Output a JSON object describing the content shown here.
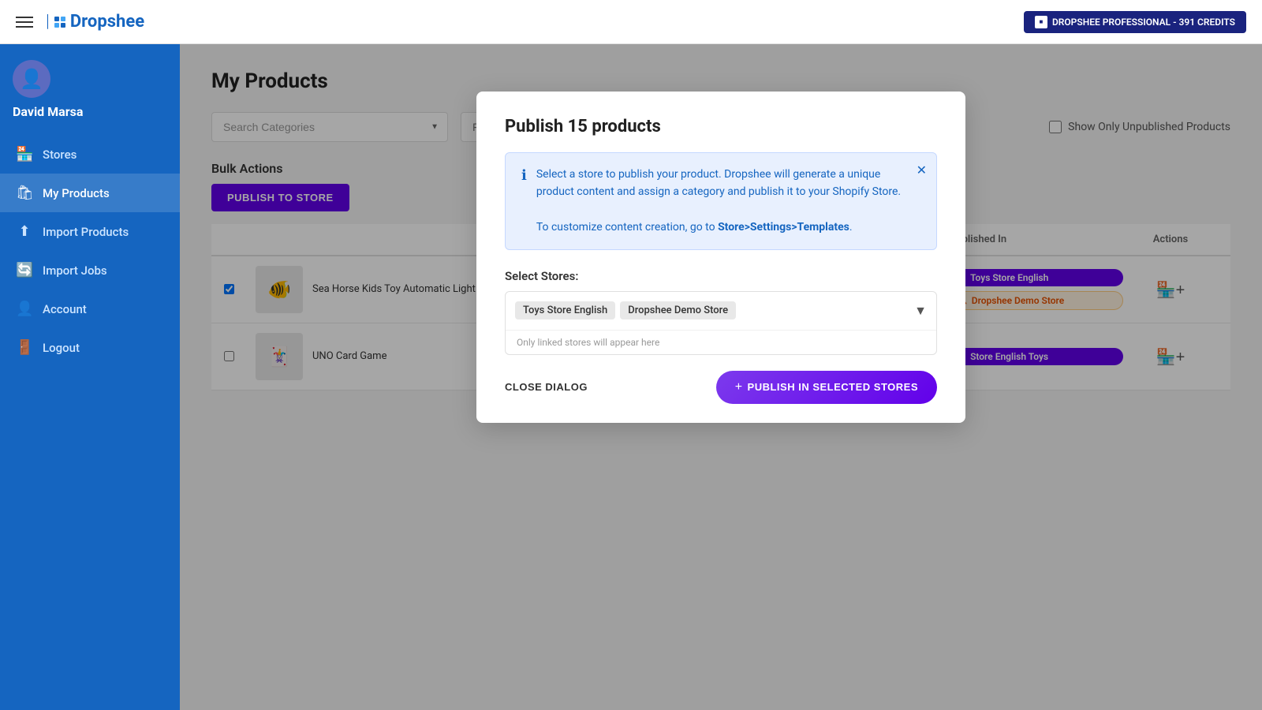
{
  "topbar": {
    "logo_text": "Dropshee",
    "credits_label": "DROPSHEE PROFESSIONAL - 391 CREDITS"
  },
  "sidebar": {
    "username": "David Marsa",
    "nav_items": [
      {
        "id": "stores",
        "label": "Stores",
        "icon": "🏪"
      },
      {
        "id": "my-products",
        "label": "My Products",
        "icon": "🛍",
        "active": true
      },
      {
        "id": "import-products",
        "label": "Import Products",
        "icon": "⬆"
      },
      {
        "id": "import-jobs",
        "label": "Import Jobs",
        "icon": "🔄"
      },
      {
        "id": "account",
        "label": "Account",
        "icon": "👤"
      },
      {
        "id": "logout",
        "label": "Logout",
        "icon": "🚪"
      }
    ]
  },
  "main": {
    "page_title": "My Products",
    "search_categories_placeholder": "Search Categories",
    "filter_name_placeholder": "Filter by Name",
    "unpublished_label": "Show Only Unpublished Products",
    "bulk_actions_label": "Bulk Actions",
    "publish_to_store_btn": "PUBLISH TO STORE",
    "table_headers": {
      "published_in": "Published In",
      "actions": "Actions"
    },
    "products": [
      {
        "id": 1,
        "name": "Sea Horse Kids Toy Automatic Light Summer Games Children Gift",
        "stores": [
          {
            "label": "Toys Store English",
            "type": "published"
          },
          {
            "label": "Dropshee Demo Store",
            "type": "warning"
          }
        ]
      },
      {
        "id": 2,
        "name": "UNO Card Game",
        "stores": [
          {
            "label": "Store English Toys",
            "type": "published"
          }
        ]
      }
    ]
  },
  "dialog": {
    "title": "Publish 15 products",
    "info_text_1": "Select a store to publish your product. Dropshee will generate a unique product content and assign a category and publish it to your Shopify Store.",
    "info_text_2": "To customize content creation, go to",
    "info_link": "Store>Settings>Templates",
    "select_stores_label": "Select Stores:",
    "selected_stores": [
      {
        "label": "Toys Store English"
      },
      {
        "label": "Dropshee Demo Store"
      }
    ],
    "only_linked_text": "Only linked stores will appear here",
    "close_btn": "CLOSE DIALOG",
    "publish_btn": "+ PUBLISH IN SELECTED STORES"
  }
}
